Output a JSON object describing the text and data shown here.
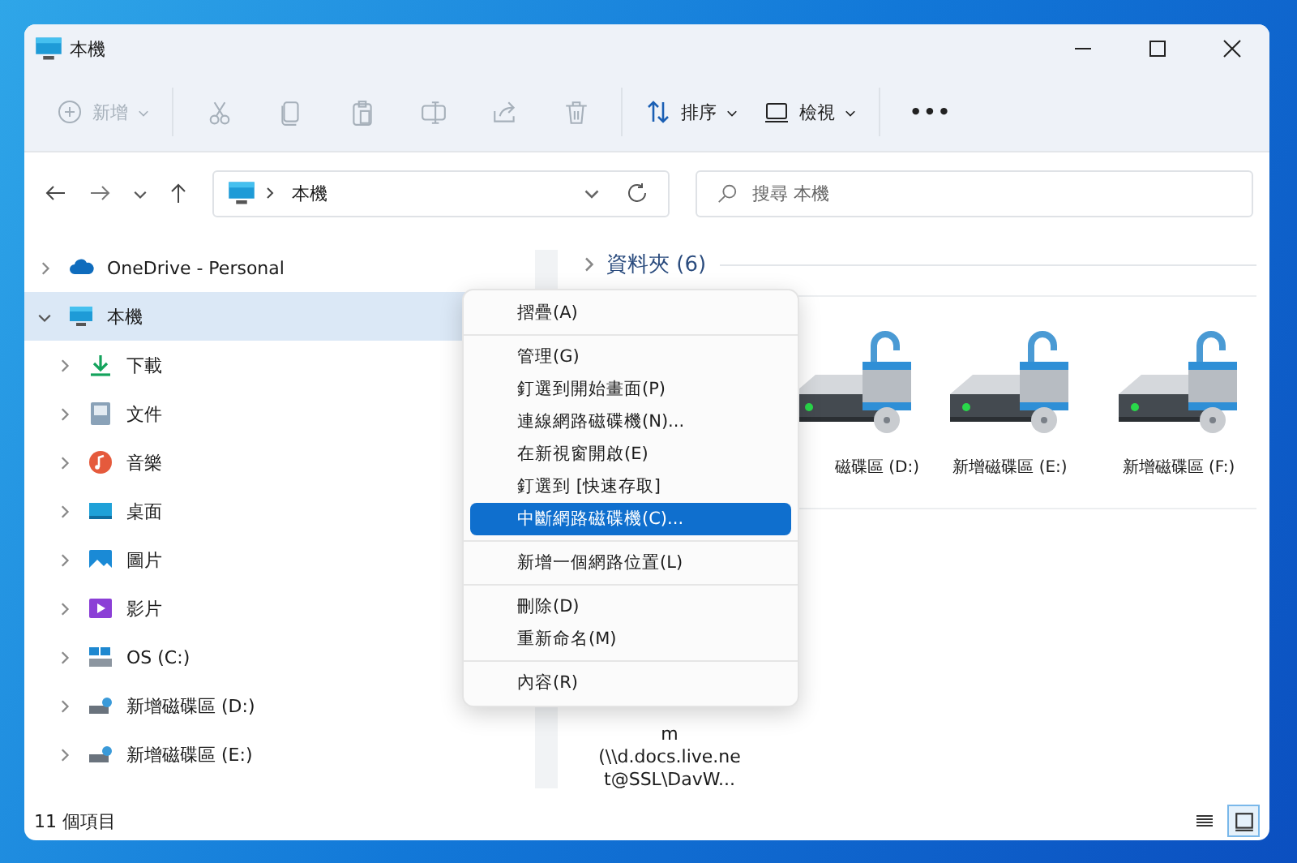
{
  "window": {
    "title": "本機"
  },
  "toolbar": [
    {
      "kind": "new",
      "label": "新增",
      "disabled": true
    },
    {
      "kind": "cut",
      "disabled": true
    },
    {
      "kind": "copy",
      "disabled": true
    },
    {
      "kind": "paste",
      "disabled": true
    },
    {
      "kind": "rename",
      "disabled": true
    },
    {
      "kind": "share",
      "disabled": true
    },
    {
      "kind": "delete",
      "disabled": true
    },
    {
      "kind": "sort",
      "label": "排序",
      "disabled": false
    },
    {
      "kind": "view",
      "label": "檢視",
      "disabled": false
    },
    {
      "kind": "more",
      "label": "•••",
      "disabled": false
    }
  ],
  "address": {
    "path": "本機"
  },
  "search": {
    "placeholder": "搜尋 本機"
  },
  "sidebar": {
    "items": [
      {
        "label": "OneDrive - Personal",
        "kind": "cloud",
        "expanded": false,
        "selected": false
      },
      {
        "label": "本機",
        "kind": "pc",
        "expanded": true,
        "selected": true,
        "children": [
          {
            "label": "下載",
            "kind": "download",
            "expanded": false,
            "selected": false
          },
          {
            "label": "文件",
            "kind": "docs",
            "expanded": false,
            "selected": false
          },
          {
            "label": "音樂",
            "kind": "music",
            "expanded": false,
            "selected": false
          },
          {
            "label": "桌面",
            "kind": "desktop",
            "expanded": false,
            "selected": false
          },
          {
            "label": "圖片",
            "kind": "pictures",
            "expanded": false,
            "selected": false
          },
          {
            "label": "影片",
            "kind": "videos",
            "expanded": false,
            "selected": false
          },
          {
            "label": "OS (C:)",
            "kind": "os",
            "expanded": false,
            "selected": false
          },
          {
            "label": "新增磁碟區 (D:)",
            "kind": "drive",
            "expanded": false,
            "selected": false
          },
          {
            "label": "新增磁碟區 (E:)",
            "kind": "drive",
            "expanded": false,
            "selected": false
          }
        ]
      }
    ]
  },
  "content": {
    "section": {
      "label": "資料夾 (6)",
      "expanded": false
    },
    "drives": [
      {
        "label": "磁碟區 (D:)"
      },
      {
        "label": "新增磁碟區 (E:)"
      },
      {
        "label": "新增磁碟區 (F:)"
      }
    ],
    "network_lines": [
      "m",
      "(\\\\d.docs.live.ne",
      "t@SSL\\DavW..."
    ]
  },
  "context_menu": [
    {
      "kind": "item",
      "label": "摺疊(A)",
      "selected": false
    },
    {
      "kind": "separator"
    },
    {
      "kind": "item",
      "label": "管理(G)",
      "selected": false
    },
    {
      "kind": "item",
      "label": "釘選到開始畫面(P)",
      "selected": false
    },
    {
      "kind": "item",
      "label": "連線網路磁碟機(N)...",
      "selected": false
    },
    {
      "kind": "item",
      "label": "在新視窗開啟(E)",
      "selected": false
    },
    {
      "kind": "item",
      "label": "釘選到 [快速存取]",
      "selected": false
    },
    {
      "kind": "item",
      "label": "中斷網路磁碟機(C)...",
      "selected": true
    },
    {
      "kind": "separator"
    },
    {
      "kind": "item",
      "label": "新增一個網路位置(L)",
      "selected": false
    },
    {
      "kind": "separator"
    },
    {
      "kind": "item",
      "label": "刪除(D)",
      "selected": false
    },
    {
      "kind": "item",
      "label": "重新命名(M)",
      "selected": false
    },
    {
      "kind": "separator"
    },
    {
      "kind": "item",
      "label": "內容(R)",
      "selected": false
    }
  ],
  "status_bar": {
    "count": "11 個項目",
    "view_modes": [
      {
        "kind": "details",
        "selected": false
      },
      {
        "kind": "tiles",
        "selected": true
      }
    ]
  }
}
